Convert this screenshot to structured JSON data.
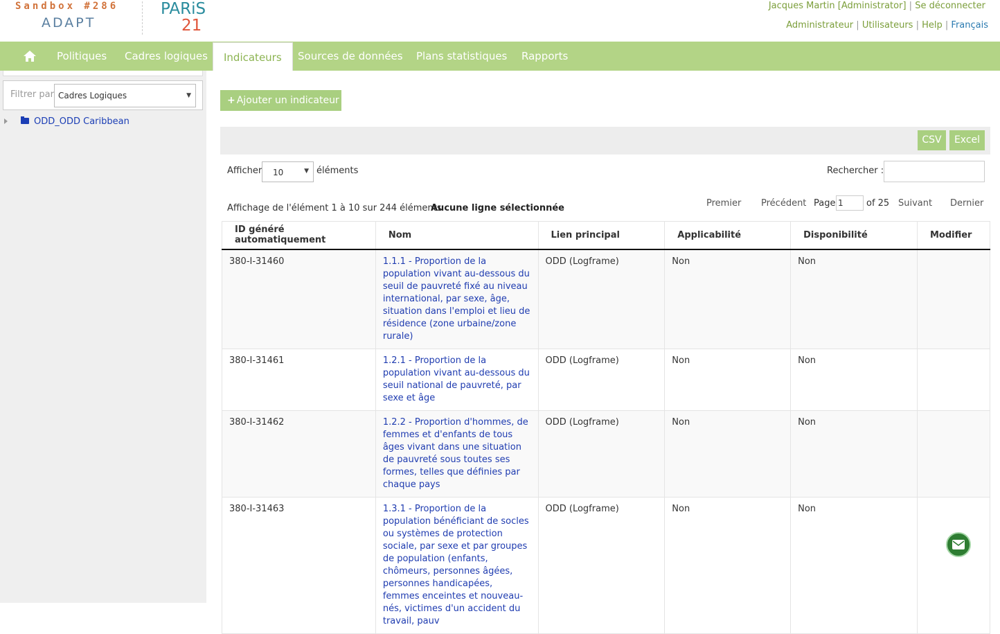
{
  "brand": {
    "sandbox": "Sandbox #286",
    "adapt": "ADAPT",
    "paris": "PARiS",
    "paris21": "21"
  },
  "user": {
    "name": "Jacques Martin [Administrator]",
    "logout": "Se déconnecter"
  },
  "admin_links": {
    "admin": "Administrateur",
    "users": "Utilisateurs",
    "help": "Help",
    "lang": "Français"
  },
  "nav": {
    "home_icon": "home-icon",
    "items": [
      "Politiques",
      "Cadres logiques",
      "Indicateurs",
      "Sources de données",
      "Plans statistiques",
      "Rapports"
    ],
    "active": "Indicateurs"
  },
  "sidebar": {
    "filter_label": "Filtrer par",
    "filter_value": "Cadres Logiques",
    "tree": [
      {
        "label": "ODD_ODD Caribbean"
      }
    ]
  },
  "main": {
    "add_button": "Ajouter un indicateur",
    "export": {
      "csv": "CSV",
      "excel": "Excel"
    },
    "show_label": "Afficher",
    "show_value": "10",
    "show_suffix": "éléments",
    "search_label": "Rechercher :",
    "info": "Affichage de l'élément 1 à 10 sur 244 éléments",
    "selection": "Aucune ligne sélectionnée",
    "pagination": {
      "first": "Premier",
      "prev": "Précédent",
      "page_label": "Page",
      "page": "1",
      "of": "of 25",
      "next": "Suivant",
      "last": "Dernier"
    }
  },
  "table": {
    "headers": [
      "ID généré automatiquement",
      "Nom",
      "Lien principal",
      "Applicabilité",
      "Disponibilité",
      "Modifier"
    ],
    "rows": [
      {
        "id": "380-I-31460",
        "name": "1.1.1 - Proportion de la population vivant au-dessous du seuil de pauvreté fixé au niveau international, par sexe, âge, situation dans l'emploi et lieu de résidence (zone urbaine/zone rurale)",
        "link": "ODD (Logframe)",
        "applicability": "Non",
        "availability": "Non"
      },
      {
        "id": "380-I-31461",
        "name": "1.2.1 - Proportion de la population vivant au-dessous du seuil national de pauvreté, par sexe et âge",
        "link": "ODD (Logframe)",
        "applicability": "Non",
        "availability": "Non"
      },
      {
        "id": "380-I-31462",
        "name": "1.2.2 - Proportion d'hommes, de femmes et d'enfants de tous âges vivant dans une situation de pauvreté sous toutes ses formes, telles que définies par chaque pays",
        "link": "ODD (Logframe)",
        "applicability": "Non",
        "availability": "Non"
      },
      {
        "id": "380-I-31463",
        "name": "1.3.1 - Proportion de la population bénéficiant de socles ou systèmes de protection sociale, par sexe et par groupes de population (enfants, chômeurs, personnes âgées, personnes handicapées, femmes enceintes et nouveau-nés, victimes d'un accident du travail, pauv",
        "link": "ODD (Logframe)",
        "applicability": "Non",
        "availability": "Non"
      }
    ]
  },
  "chat_icon": "envelope-icon"
}
